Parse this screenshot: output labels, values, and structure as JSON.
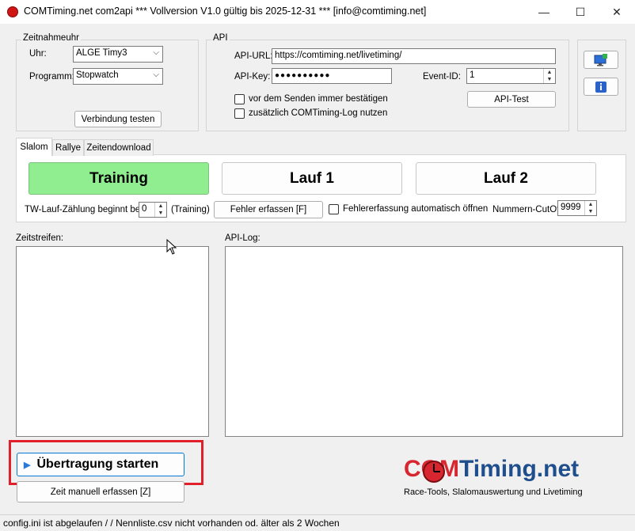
{
  "window": {
    "title": "COMTiming.net com2api *** Vollversion V1.0 gültig bis 2025-12-31 *** [info@comtiming.net]",
    "minimize_glyph": "—",
    "maximize_glyph": "☐",
    "close_glyph": "✕"
  },
  "timing": {
    "group_label": "Zeitnahmeuhr",
    "clock_label": "Uhr:",
    "clock_value": "ALGE Timy3",
    "program_label": "Programm:",
    "program_value": "Stopwatch",
    "test_button": "Verbindung testen"
  },
  "api": {
    "group_label": "API",
    "url_label": "API-URL:",
    "url_value": "https://comtiming.net/livetiming/",
    "key_label": "API-Key:",
    "key_value": "●●●●●●●●●●",
    "event_label": "Event-ID:",
    "event_value": "1",
    "confirm_label": "vor dem Senden immer bestätigen",
    "log_label": "zusätzlich COMTiming-Log nutzen",
    "test_button": "API-Test"
  },
  "side": {
    "monitor_icon": "monitor-add-icon",
    "info_icon": "info-icon"
  },
  "tabs": {
    "slalom": "Slalom",
    "rallye": "Rallye",
    "download": "Zeitendownload"
  },
  "slalom": {
    "training_button": "Training",
    "run1_button": "Lauf 1",
    "run2_button": "Lauf 2",
    "count_label": "TW-Lauf-Zählung beginnt bei:",
    "count_value": "0",
    "count_suffix": "(Training)",
    "error_button": "Fehler erfassen [F]",
    "auto_open_label": "Fehlererfassung automatisch öffnen",
    "cutoff_label": "Nummern-CutOff:",
    "cutoff_value": "9999"
  },
  "lists": {
    "times_label": "Zeitstreifen:",
    "log_label": "API-Log:"
  },
  "actions": {
    "start_button": "Übertragung starten",
    "manual_button": "Zeit manuell erfassen [Z]"
  },
  "logo": {
    "text_com": "COM",
    "text_rest": "Timing.net",
    "tagline": "Race-Tools, Slalomauswertung und Livetiming"
  },
  "status": {
    "text": "config.ini ist abgelaufen /  / Nennliste.csv  nicht vorhanden od. älter als 2 Wochen"
  },
  "colors": {
    "training_active": "#90ee90",
    "highlight_frame": "#e0202a",
    "logo_red": "#d7262f",
    "logo_blue": "#1f4e8c"
  }
}
